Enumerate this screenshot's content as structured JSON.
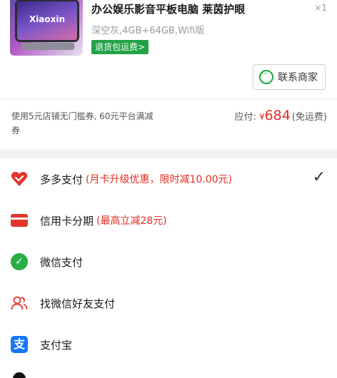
{
  "product": {
    "title": "办公娱乐影音平板电脑 莱茵护眼",
    "quantity": "×1",
    "spec": "深空灰,4GB+64GB,Wifi版",
    "badge": "退货包运费>",
    "thumb_text": "Xiaoxin"
  },
  "contact": {
    "label": "联系商家",
    "icon": "chat-icon"
  },
  "summary": {
    "coupon_text": "使用5元店铺无门槛券, 60元平台满减券",
    "payable_label": "应付:",
    "currency": "¥",
    "amount": "684",
    "shipping_note": "(免运费)"
  },
  "payment_methods": [
    {
      "label": "多多支付",
      "promo": "(月卡升级优惠，限时减10.00元)",
      "icon": "heart-icon",
      "selected": true
    },
    {
      "label": "信用卡分期",
      "promo": "(最高立减28元)",
      "icon": "credit-card-icon",
      "selected": false
    },
    {
      "label": "微信支付",
      "promo": "",
      "icon": "wechat-icon",
      "selected": false
    },
    {
      "label": "找微信好友支付",
      "promo": "",
      "icon": "friends-icon",
      "selected": false
    },
    {
      "label": "支付宝",
      "promo": "",
      "icon": "alipay-icon",
      "selected": false
    }
  ],
  "check_mark": "✓",
  "colors": {
    "accent_red": "#e02e24",
    "green": "#21a346",
    "wechat_green": "#2aae43",
    "alipay_blue": "#1677ff"
  }
}
